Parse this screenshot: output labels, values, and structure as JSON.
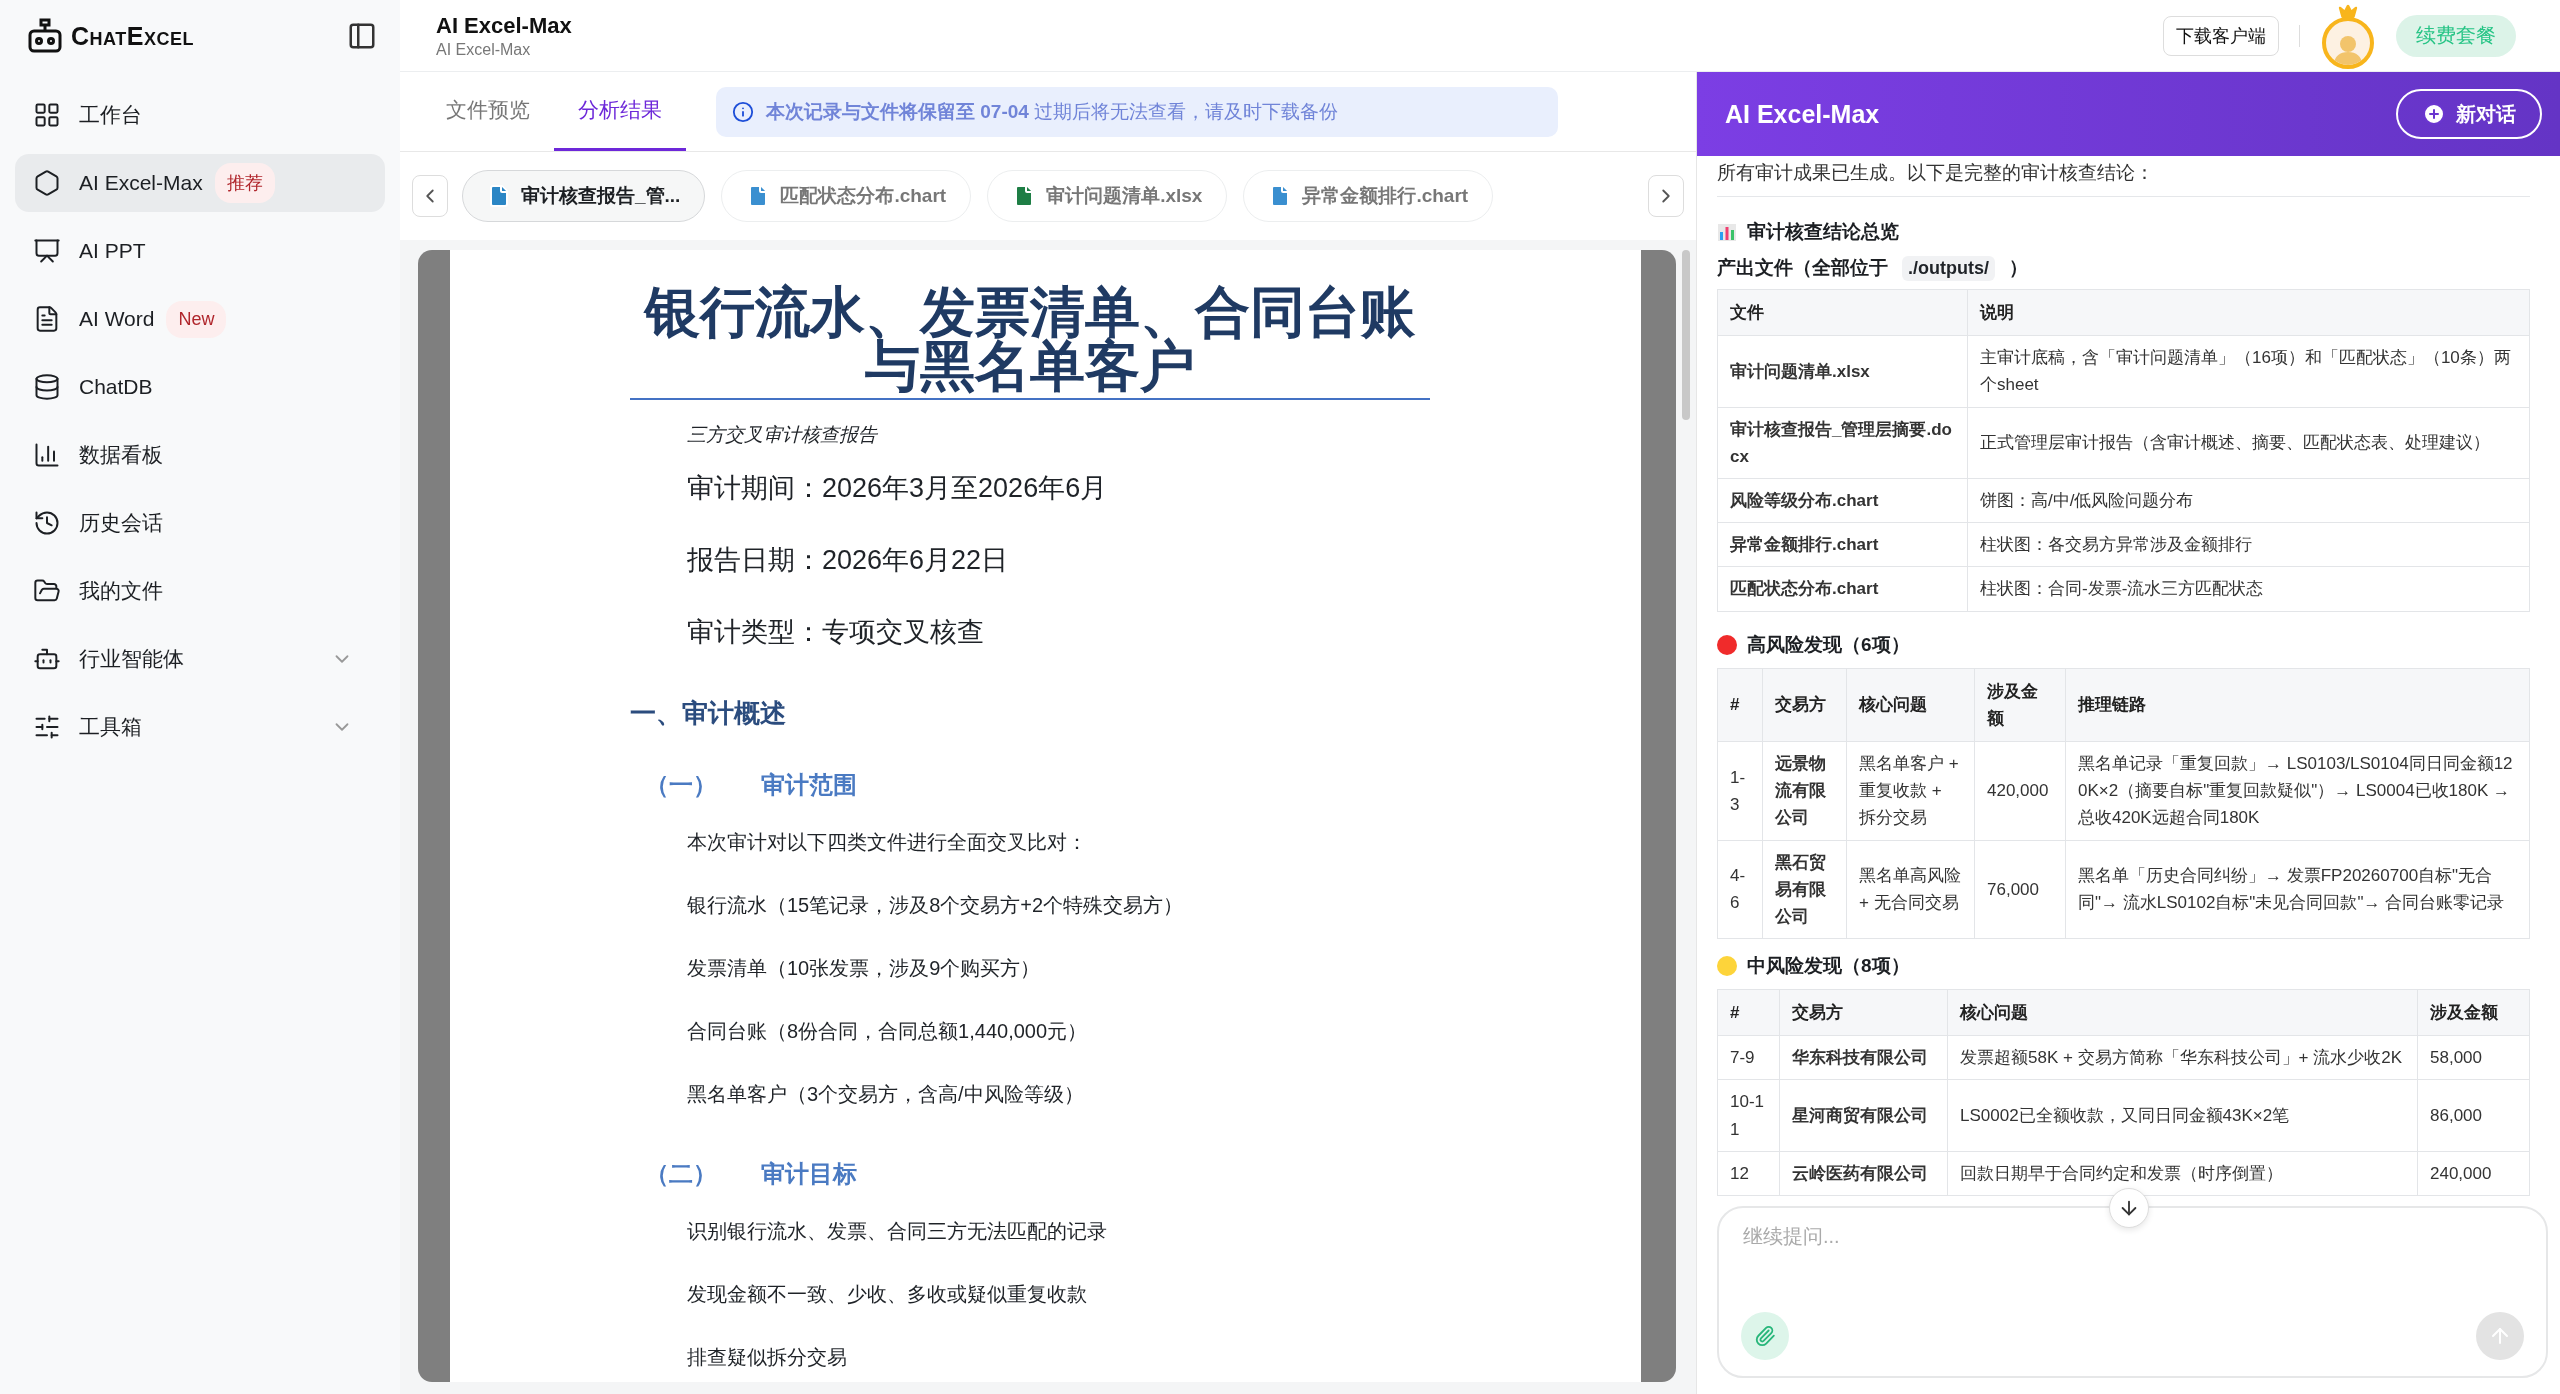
{
  "sidebar": {
    "logo": "ChatExcel",
    "items": [
      {
        "label": "工作台",
        "selected": false
      },
      {
        "label": "AI Excel-Max",
        "badge": "推荐",
        "selected": true
      },
      {
        "label": "AI PPT",
        "selected": false
      },
      {
        "label": "AI Word",
        "badge": "New",
        "selected": false
      },
      {
        "label": "ChatDB",
        "selected": false
      },
      {
        "label": "数据看板",
        "selected": false
      },
      {
        "label": "历史会话",
        "selected": false
      },
      {
        "label": "我的文件",
        "selected": false
      },
      {
        "label": "行业智能体",
        "expandable": true,
        "selected": false
      },
      {
        "label": "工具箱",
        "expandable": true,
        "selected": false
      }
    ]
  },
  "header": {
    "title": "AI Excel-Max",
    "subtitle": "AI Excel-Max",
    "download_button": "下载客户端",
    "renew_button": "续费套餐"
  },
  "tabs": [
    {
      "label": "文件预览",
      "selected": false
    },
    {
      "label": "分析结果",
      "selected": true
    }
  ],
  "notice": "**本次记录与文件将保留至 07-04** 过期后将无法查看，请及时下载备份",
  "files": [
    {
      "name": "审计核查报告_管...",
      "kind": "docx",
      "selected": true
    },
    {
      "name": "匹配状态分布.chart",
      "kind": "chart",
      "selected": false
    },
    {
      "name": "审计问题清单.xlsx",
      "kind": "xlsx",
      "selected": false
    },
    {
      "name": "异常金额排行.chart",
      "kind": "chart",
      "selected": false
    }
  ],
  "document": {
    "title": "银行流水、发票清单、合同台账与黑名单客户",
    "blocks": [
      {
        "kind": "subtitle",
        "text": "三方交叉审计核查报告"
      },
      {
        "kind": "meta",
        "text": "审计期间：2026年3月至2026年6月"
      },
      {
        "kind": "meta",
        "text": "报告日期：2026年6月22日"
      },
      {
        "kind": "meta",
        "text": "审计类型：专项交叉核查"
      },
      {
        "kind": "h1",
        "text": "一、审计概述"
      },
      {
        "kind": "h2",
        "number": "（一）",
        "text": "审计范围"
      },
      {
        "kind": "para",
        "text": "本次审计对以下四类文件进行全面交叉比对："
      },
      {
        "kind": "para",
        "text": "银行流水（15笔记录，涉及8个交易方+2个特殊交易方）"
      },
      {
        "kind": "para",
        "text": "发票清单（10张发票，涉及9个购买方）"
      },
      {
        "kind": "para",
        "text": "合同台账（8份合同，合同总额1,440,000元）"
      },
      {
        "kind": "para",
        "text": "黑名单客户（3个交易方，含高/中风险等级）"
      },
      {
        "kind": "h2",
        "number": "（二）",
        "text": "审计目标"
      },
      {
        "kind": "para",
        "text": "识别银行流水、发票、合同三方无法匹配的记录"
      },
      {
        "kind": "para",
        "text": "发现金额不一致、少收、多收或疑似重复收款"
      },
      {
        "kind": "para",
        "text": "排查疑似拆分交易"
      }
    ]
  },
  "chat": {
    "title": "AI Excel-Max",
    "new_chat_button": "新对话",
    "intro": "所有审计成果已生成。以下是完整的审计核查结论：",
    "overview_heading": "审计核查结论总览",
    "files_heading": {
      "prefix": "产出文件（全部位于",
      "path": "./outputs/",
      "suffix": "）"
    },
    "files_table": {
      "columns": [
        "文件",
        "说明"
      ],
      "rows": [
        [
          "审计问题清单.xlsx",
          "主审计底稿，含「审计问题清单」（16项）和「匹配状态」（10条）两个sheet"
        ],
        [
          "审计核查报告_管理层摘要.docx",
          "正式管理层审计报告（含审计概述、摘要、匹配状态表、处理建议）"
        ],
        [
          "风险等级分布.chart",
          "饼图：高/中/低风险问题分布"
        ],
        [
          "异常金额排行.chart",
          "柱状图：各交易方异常涉及金额排行"
        ],
        [
          "匹配状态分布.chart",
          "柱状图：合同-发票-流水三方匹配状态"
        ]
      ]
    },
    "sections": [
      {
        "title": "高风险发现（6项）",
        "color": "#f02b2b",
        "columns": [
          "#",
          "交易方",
          "核心问题",
          "涉及金额",
          "推理链路"
        ],
        "rows": [
          [
            "1-3",
            "远景物流有限公司",
            "黑名单客户 + 重复收款 + 拆分交易",
            "420,000",
            "黑名单记录「重复回款」→ LS0103/LS0104同日同金额120K×2（摘要自标\"重复回款疑似\"）→ LS0004已收180K → 总收420K远超合同180K"
          ],
          [
            "4-6",
            "黑石贸易有限公司",
            "黑名单高风险 + 无合同交易",
            "76,000",
            "黑名单「历史合同纠纷」→ 发票FP20260700自标\"无合同\"→ 流水LS0102自标\"未见合同回款\"→ 合同台账零记录"
          ]
        ]
      },
      {
        "title": "中风险发现（8项）",
        "color": "#fdd43a",
        "columns": [
          "#",
          "交易方",
          "核心问题",
          "涉及金额"
        ],
        "rows": [
          [
            "7-9",
            "华东科技有限公司",
            "发票超额58K + 交易方简称「华东科技公司」+ 流水少收2K",
            "58,000"
          ],
          [
            "10-11",
            "星河商贸有限公司",
            "LS0002已全额收款，又同日同金额43K×2笔",
            "86,000"
          ],
          [
            "12",
            "云岭医药有限公司",
            "回款日期早于合同约定和发票（时序倒置）",
            "240,000"
          ]
        ]
      }
    ],
    "input": {
      "placeholder": "继续提问..."
    }
  }
}
